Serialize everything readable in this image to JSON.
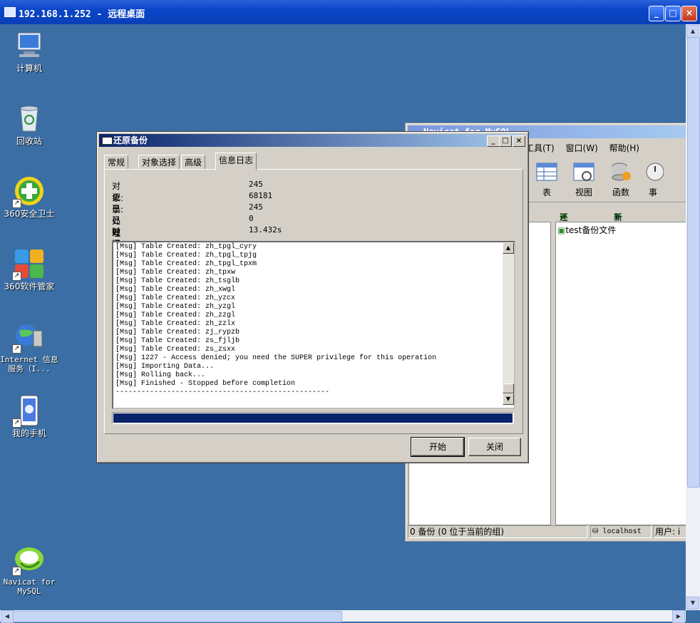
{
  "rdp": {
    "title": "192.168.1.252 - 远程桌面"
  },
  "desktop_icons": [
    {
      "label": "计算机"
    },
    {
      "label": "回收站"
    },
    {
      "label": "360安全卫士"
    },
    {
      "label": "360软件管家"
    },
    {
      "label": "Internet 信息服务（I..."
    },
    {
      "label": "我的手机"
    },
    {
      "label": "Navicat for MySQL"
    }
  ],
  "navicat": {
    "title": "Navicat for MySQL",
    "menu": [
      "工具(T)",
      "窗口(W)",
      "帮助(H)"
    ],
    "toolbar": [
      "表",
      "视图",
      "函数",
      "事"
    ],
    "sub_actions": [
      "还原备份",
      "新建备份"
    ],
    "right_item": "test备份文件",
    "status": {
      "count": "0 备份 (0 位于当前的组)",
      "conn": "localhost",
      "user": "用户: i"
    }
  },
  "dialog": {
    "title": "还原备份",
    "tabs": [
      "常规",
      "对象选择",
      "高级",
      "信息日志"
    ],
    "active_tab": "信息日志",
    "stats": [
      {
        "k": "对象:",
        "v": "245"
      },
      {
        "k": "记录:",
        "v": "68181"
      },
      {
        "k": "已处理对象:",
        "v": "245"
      },
      {
        "k": "已处理记录:",
        "v": "0"
      },
      {
        "k": "时间:",
        "v": "13.432s"
      }
    ],
    "log": [
      "[Msg] Table Created: zh_tpgl_cyry",
      "[Msg] Table Created: zh_tpgl_tpjg",
      "[Msg] Table Created: zh_tpgl_tpxm",
      "[Msg] Table Created: zh_tpxw",
      "[Msg] Table Created: zh_tsglb",
      "[Msg] Table Created: zh_xwgl",
      "[Msg] Table Created: zh_yzcx",
      "[Msg] Table Created: zh_yzgl",
      "[Msg] Table Created: zh_zzgl",
      "[Msg] Table Created: zh_zzlx",
      "[Msg] Table Created: zj_rypzb",
      "[Msg] Table Created: zs_fjljb",
      "[Msg] Table Created: zs_zsxx",
      "[Msg] 1227 - Access denied; you need the SUPER privilege for this operation",
      "[Msg] Importing Data...",
      "[Msg] Rolling back...",
      "[Msg] Finished - Stopped before completion",
      "--------------------------------------------------"
    ],
    "progress": 1.0,
    "buttons": {
      "start": "开始",
      "close": "关闭"
    }
  }
}
